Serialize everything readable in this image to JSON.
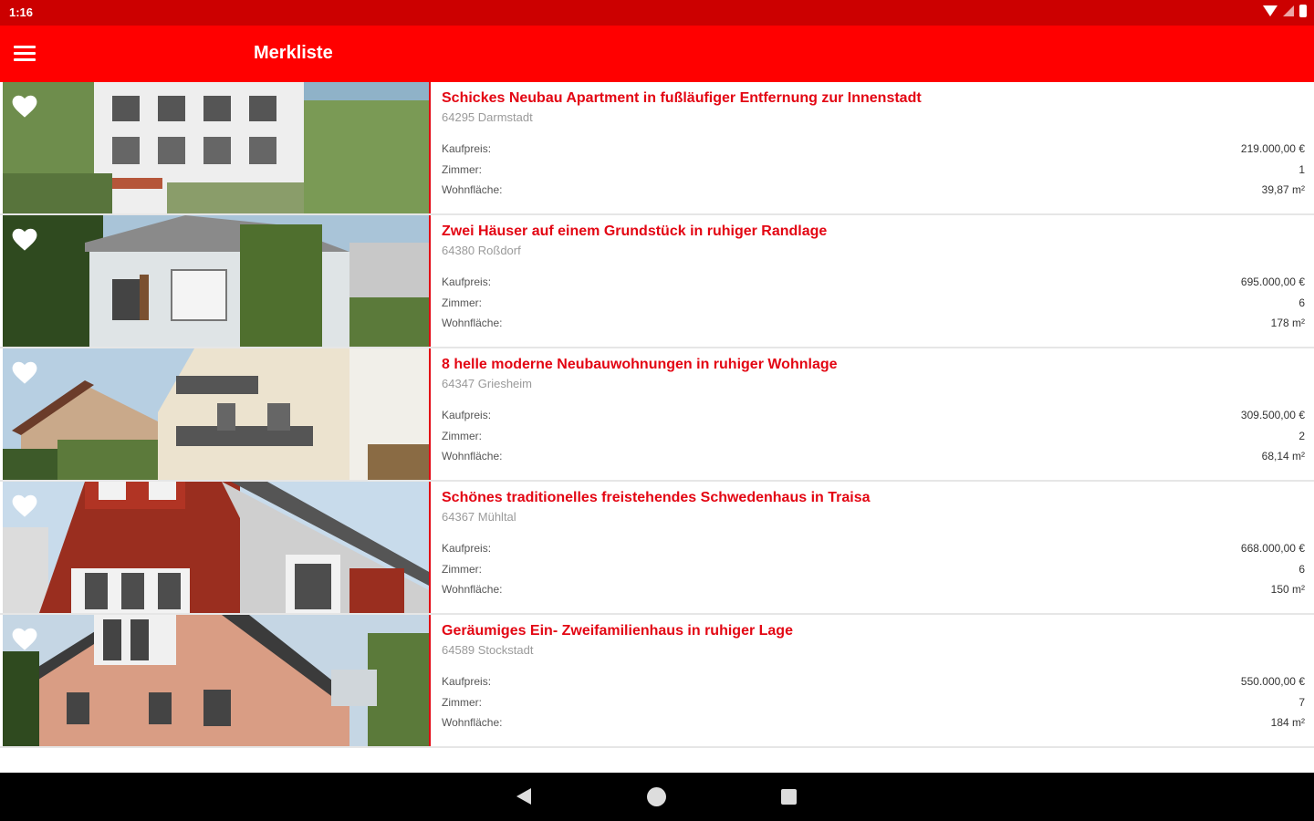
{
  "status_bar": {
    "time": "1:16"
  },
  "app_bar": {
    "title": "Merkliste"
  },
  "listings": [
    {
      "title": "Schickes Neubau Apartment in fußläufiger Entfernung zur Innenstadt",
      "location": "64295 Darmstadt",
      "labels": {
        "price": "Kaufpreis:",
        "rooms": "Zimmer:",
        "area": "Wohnfläche:"
      },
      "price": "219.000,00 €",
      "rooms": "1",
      "area": "39,87 m²"
    },
    {
      "title": "Zwei Häuser auf einem Grundstück in ruhiger Randlage",
      "location": "64380 Roßdorf",
      "labels": {
        "price": "Kaufpreis:",
        "rooms": "Zimmer:",
        "area": "Wohnfläche:"
      },
      "price": "695.000,00 €",
      "rooms": "6",
      "area": "178 m²"
    },
    {
      "title": "8 helle moderne Neubauwohnungen in ruhiger Wohnlage",
      "location": "64347 Griesheim",
      "labels": {
        "price": "Kaufpreis:",
        "rooms": "Zimmer:",
        "area": "Wohnfläche:"
      },
      "price": "309.500,00 €",
      "rooms": "2",
      "area": "68,14 m²"
    },
    {
      "title": "Schönes traditionelles freistehendes Schwedenhaus in Traisa",
      "location": "64367 Mühltal",
      "labels": {
        "price": "Kaufpreis:",
        "rooms": "Zimmer:",
        "area": "Wohnfläche:"
      },
      "price": "668.000,00 €",
      "rooms": "6",
      "area": "150 m²"
    },
    {
      "title": "Geräumiges Ein- Zweifamilienhaus in ruhiger Lage",
      "location": "64589 Stockstadt",
      "labels": {
        "price": "Kaufpreis:",
        "rooms": "Zimmer:",
        "area": "Wohnfläche:"
      },
      "price": "550.000,00 €",
      "rooms": "7",
      "area": "184 m²"
    }
  ],
  "colors": {
    "status_bar": "#cc0000",
    "app_bar": "#ff0000",
    "accent": "#e30613"
  },
  "icons": {
    "menu": "menu-icon",
    "favorite": "heart-icon",
    "nav_back": "back-icon",
    "nav_home": "home-icon",
    "nav_recent": "recent-apps-icon"
  }
}
